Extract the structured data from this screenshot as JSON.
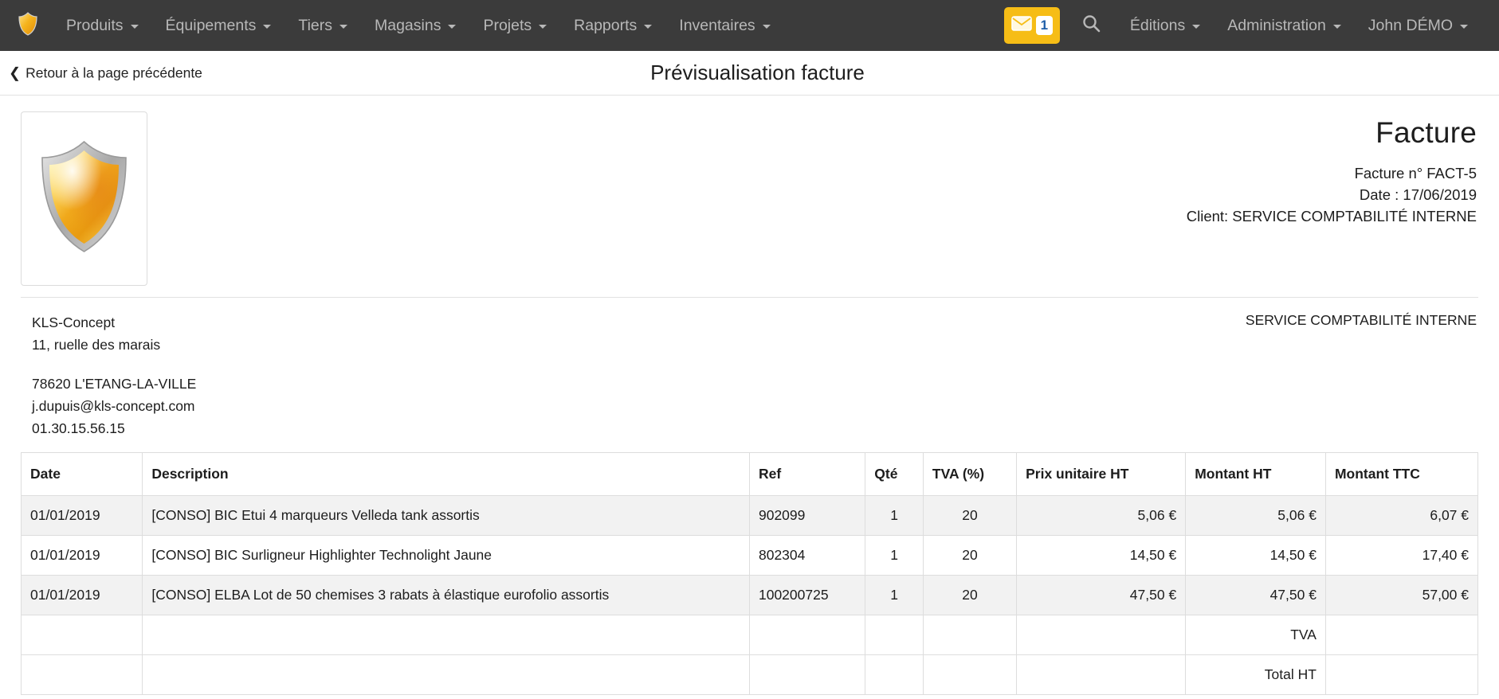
{
  "navbar": {
    "brand_icon": "shield-logo-icon",
    "accent_color": "#f6bd16",
    "background_color": "#3b3b3b",
    "left_items": [
      {
        "label": "Produits",
        "has_caret": true
      },
      {
        "label": "Équipements",
        "has_caret": true
      },
      {
        "label": "Tiers",
        "has_caret": true
      },
      {
        "label": "Magasins",
        "has_caret": true
      },
      {
        "label": "Projets",
        "has_caret": true
      },
      {
        "label": "Rapports",
        "has_caret": true
      },
      {
        "label": "Inventaires",
        "has_caret": true
      }
    ],
    "mail": {
      "icon": "envelope-icon",
      "badge_count": "1"
    },
    "search": {
      "icon": "search-icon"
    },
    "right_items": [
      {
        "label": "Éditions",
        "has_caret": true
      },
      {
        "label": "Administration",
        "has_caret": true
      },
      {
        "label": "John DÉMO",
        "has_caret": true
      }
    ]
  },
  "page_header": {
    "back_label": "Retour à la page précédente",
    "back_icon": "chevron-left-icon",
    "title": "Prévisualisation facture"
  },
  "invoice": {
    "logo_icon": "shield-logo-image",
    "heading": "Facture",
    "number_line": "Facture n° FACT-5",
    "date_line": "Date : 17/06/2019",
    "client_line": "Client: SERVICE COMPTABILITÉ INTERNE",
    "issuer": {
      "name": "KLS-Concept",
      "street": "11, ruelle des marais",
      "city": "78620 L'ETANG-LA-VILLE",
      "email": "j.dupuis@kls-concept.com",
      "phone": "01.30.15.56.15"
    },
    "client_name": "SERVICE COMPTABILITÉ INTERNE",
    "table": {
      "columns": [
        "Date",
        "Description",
        "Ref",
        "Qté",
        "TVA (%)",
        "Prix unitaire HT",
        "Montant HT",
        "Montant TTC"
      ],
      "rows": [
        {
          "date": "01/01/2019",
          "description": "[CONSO] BIC Etui 4 marqueurs Velleda tank assortis",
          "ref": "902099",
          "qte": "1",
          "tva": "20",
          "pu_ht": "5,06 €",
          "montant_ht": "5,06 €",
          "montant_ttc": "6,07 €"
        },
        {
          "date": "01/01/2019",
          "description": "[CONSO] BIC Surligneur Highlighter Technolight Jaune",
          "ref": "802304",
          "qte": "1",
          "tva": "20",
          "pu_ht": "14,50 €",
          "montant_ht": "14,50 €",
          "montant_ttc": "17,40 €"
        },
        {
          "date": "01/01/2019",
          "description": "[CONSO] ELBA Lot de 50 chemises 3 rabats à élastique eurofolio assortis",
          "ref": "100200725",
          "qte": "1",
          "tva": "20",
          "pu_ht": "47,50 €",
          "montant_ht": "47,50 €",
          "montant_ttc": "57,00 €"
        }
      ],
      "summary_rows": [
        {
          "label": "TVA",
          "value": ""
        },
        {
          "label": "Total HT",
          "value": ""
        }
      ]
    }
  }
}
